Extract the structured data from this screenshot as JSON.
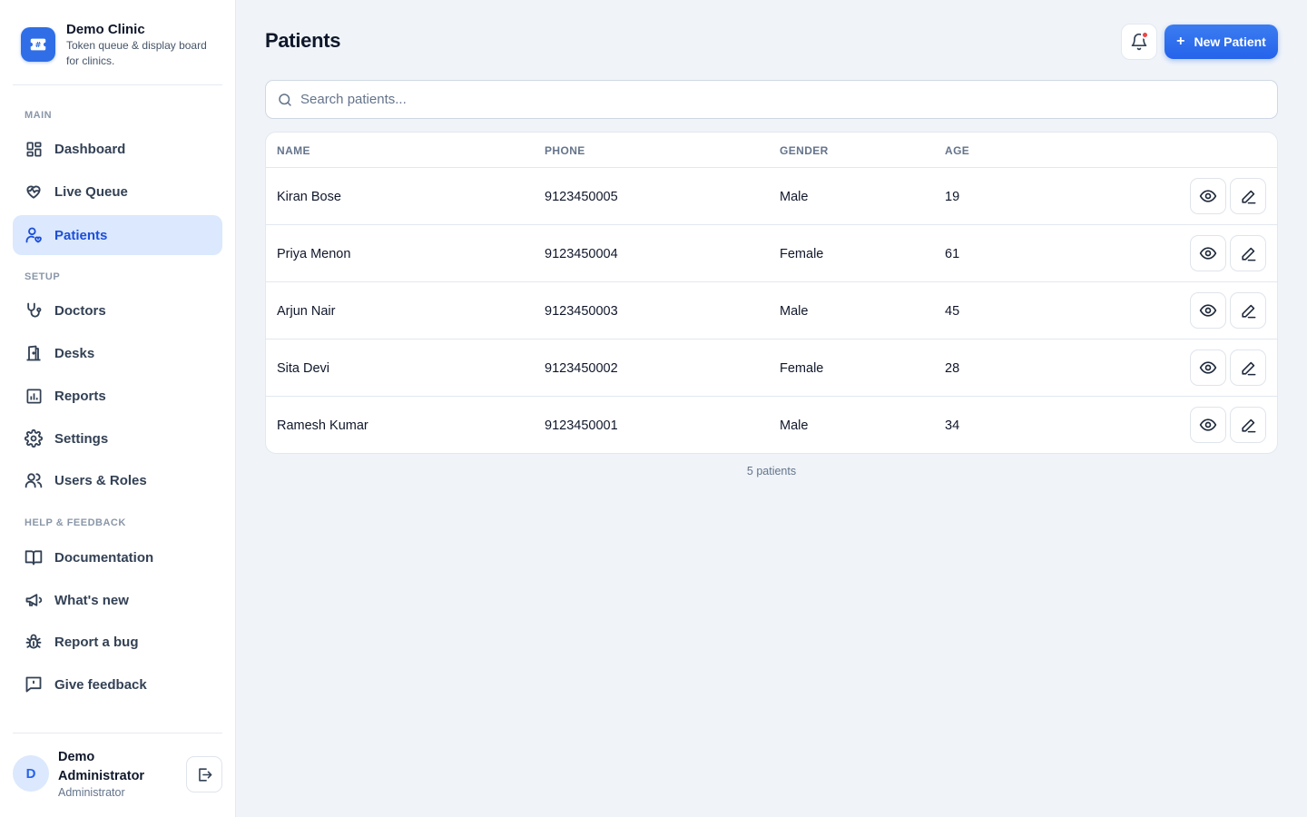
{
  "brand": {
    "name": "Demo Clinic",
    "tagline": "Token queue & display board for clinics."
  },
  "nav": {
    "sections": {
      "main": "MAIN",
      "setup": "SETUP",
      "help": "HELP & FEEDBACK"
    },
    "items": {
      "dashboard": "Dashboard",
      "live_queue": "Live Queue",
      "patients": "Patients",
      "doctors": "Doctors",
      "desks": "Desks",
      "reports": "Reports",
      "settings": "Settings",
      "users_roles": "Users & Roles",
      "documentation": "Documentation",
      "whats_new": "What's new",
      "report_bug": "Report a bug",
      "give_feedback": "Give feedback"
    },
    "active": "patients"
  },
  "user": {
    "initial": "D",
    "name": "Demo Administrator",
    "role": "Administrator"
  },
  "header": {
    "title": "Patients",
    "new_button": "New Patient",
    "notification_dot_color": "#ef4444"
  },
  "search": {
    "placeholder": "Search patients...",
    "value": ""
  },
  "table": {
    "columns": {
      "name": "NAME",
      "phone": "PHONE",
      "gender": "GENDER",
      "age": "AGE"
    },
    "rows": [
      {
        "name": "Kiran Bose",
        "phone": "9123450005",
        "gender": "Male",
        "age": "19"
      },
      {
        "name": "Priya Menon",
        "phone": "9123450004",
        "gender": "Female",
        "age": "61"
      },
      {
        "name": "Arjun Nair",
        "phone": "9123450003",
        "gender": "Male",
        "age": "45"
      },
      {
        "name": "Sita Devi",
        "phone": "9123450002",
        "gender": "Female",
        "age": "28"
      },
      {
        "name": "Ramesh Kumar",
        "phone": "9123450001",
        "gender": "Male",
        "age": "34"
      }
    ],
    "row_actions": [
      "eye-icon",
      "edit-icon"
    ]
  },
  "footer": {
    "count_label": "5 patients"
  },
  "colors": {
    "accent": "#2563eb",
    "active_bg": "#dbe8fd",
    "page_bg": "#f0f4f9"
  }
}
